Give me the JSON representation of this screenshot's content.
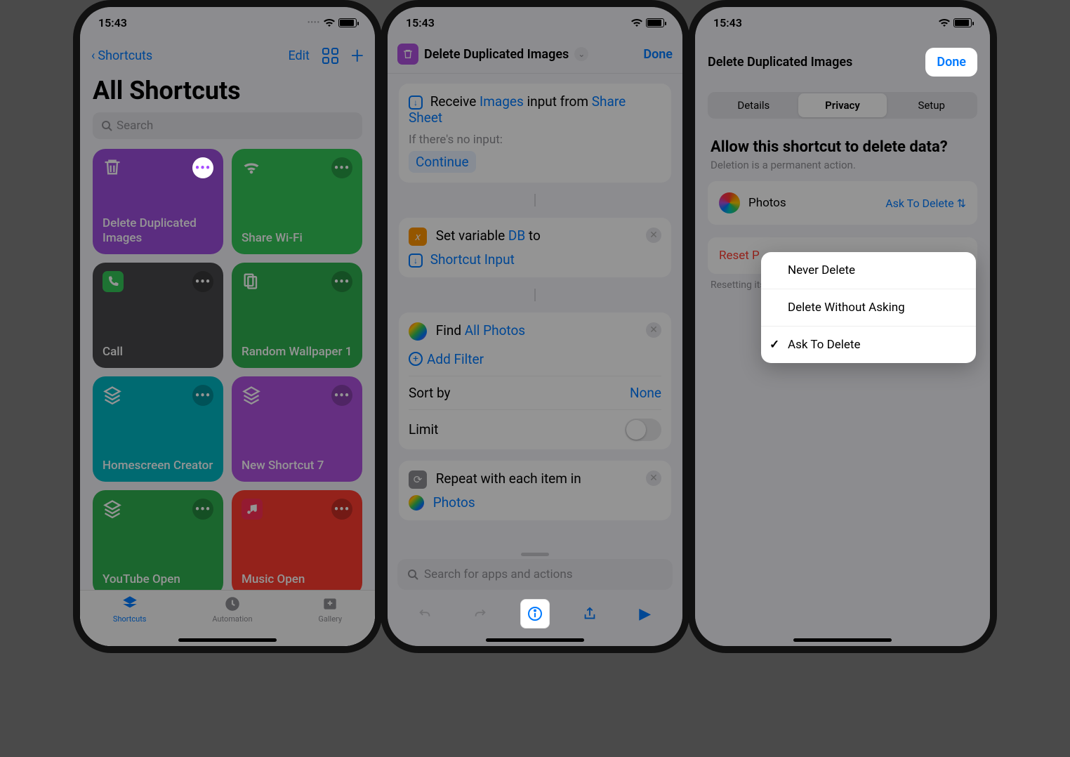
{
  "status": {
    "time": "15:43"
  },
  "screen1": {
    "back": "Shortcuts",
    "edit": "Edit",
    "title": "All Shortcuts",
    "search_ph": "Search",
    "tiles": [
      {
        "label": "Delete Duplicated Images"
      },
      {
        "label": "Share Wi-Fi"
      },
      {
        "label": "Call"
      },
      {
        "label": "Random Wallpaper 1"
      },
      {
        "label": "Homescreen Creator"
      },
      {
        "label": "New Shortcut 7"
      },
      {
        "label": "YouTube Open"
      },
      {
        "label": "Music Open"
      }
    ],
    "tabs": {
      "shortcuts": "Shortcuts",
      "automation": "Automation",
      "gallery": "Gallery"
    }
  },
  "screen2": {
    "title": "Delete Duplicated Images",
    "done": "Done",
    "receive": "Receive",
    "images": "Images",
    "input_word": "input",
    "from": "from",
    "share_sheet": "Share Sheet",
    "if_none": "If there's no input:",
    "cont": "Continue",
    "setvar": "Set variable",
    "db": "DB",
    "to": "to",
    "shortcut_input": "Shortcut Input",
    "find": "Find",
    "all_photos": "All Photos",
    "add_filter": "Add Filter",
    "sort_by": "Sort by",
    "none": "None",
    "limit": "Limit",
    "repeat": "Repeat with each item in",
    "photos": "Photos",
    "search_ph": "Search for apps and actions"
  },
  "screen3": {
    "title": "Delete Duplicated Images",
    "done": "Done",
    "tabs": {
      "details": "Details",
      "privacy": "Privacy",
      "setup": "Setup"
    },
    "heading": "Allow this shortcut to delete data?",
    "sub": "Deletion is a permanent action.",
    "photos": "Photos",
    "ask": "Ask To Delete",
    "reset": "Reset P",
    "reset_note": "Resetting its action",
    "options": [
      "Never Delete",
      "Delete Without Asking",
      "Ask To Delete"
    ]
  }
}
